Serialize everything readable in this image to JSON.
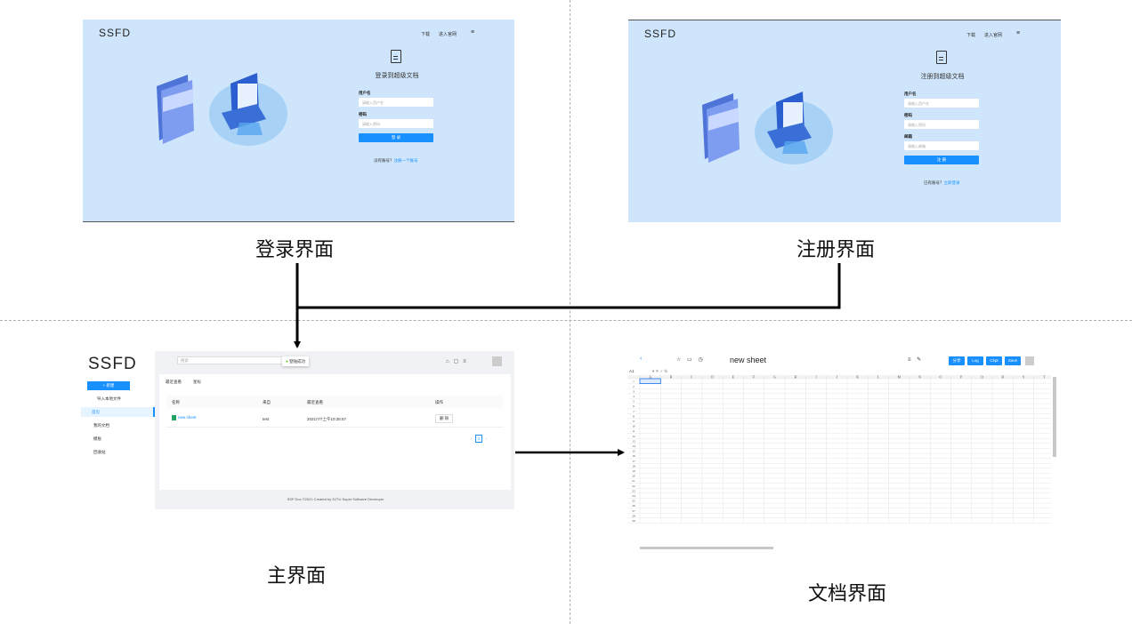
{
  "captions": {
    "login": "登录界面",
    "register": "注册界面",
    "main": "主界面",
    "document": "文档界面"
  },
  "login_panel": {
    "logo": "SSFD",
    "nav": [
      "下载",
      "进入官网",
      "≡"
    ],
    "title": "登录到超级文档",
    "username_label": "用户名",
    "username_placeholder": "请输入用户名",
    "password_label": "密码",
    "password_placeholder": "请输入密码",
    "button": "登 录",
    "footer_text": "没有账号？",
    "footer_link": "注册一个账号"
  },
  "register_panel": {
    "logo": "SSFD",
    "nav": [
      "下载",
      "进入官网",
      "≡"
    ],
    "title": "注册到超级文档",
    "username_label": "用户名",
    "username_placeholder": "请输入用户名",
    "password_label": "密码",
    "password_placeholder": "请输入密码",
    "email_label": "邮箱",
    "email_placeholder": "请输入邮箱",
    "button": "注 册",
    "footer_text": "已有账号？",
    "footer_link": "立即登录"
  },
  "main_ui": {
    "logo": "SSFD",
    "search_placeholder": "搜索",
    "toast": "登陆成功",
    "new_button": "+ 新建",
    "import": "导入本地文件",
    "sidebar": [
      "首页",
      "我的文档",
      "模板",
      "回收站"
    ],
    "tabs": [
      "最近查看",
      "星标"
    ],
    "table_headers": [
      "名称",
      "来自",
      "最近查看",
      "操作"
    ],
    "row": {
      "name": "new sheet",
      "from": "test",
      "time": "2021/7/7上午10:35:57",
      "action": "删 除"
    },
    "pagination": "1",
    "footer": "SSF Doc ©2021 Created by SJTU Super Software Developer"
  },
  "sheet_ui": {
    "title": "new sheet",
    "cell_ref": "A1",
    "buttons": [
      "分享",
      "Log",
      "Ckpt",
      "Save"
    ],
    "columns": [
      "A",
      "B",
      "C",
      "D",
      "E",
      "F",
      "G",
      "H",
      "I",
      "J",
      "K",
      "L",
      "M",
      "N",
      "O",
      "P",
      "Q",
      "R",
      "S",
      "T"
    ],
    "row_count": 29
  }
}
